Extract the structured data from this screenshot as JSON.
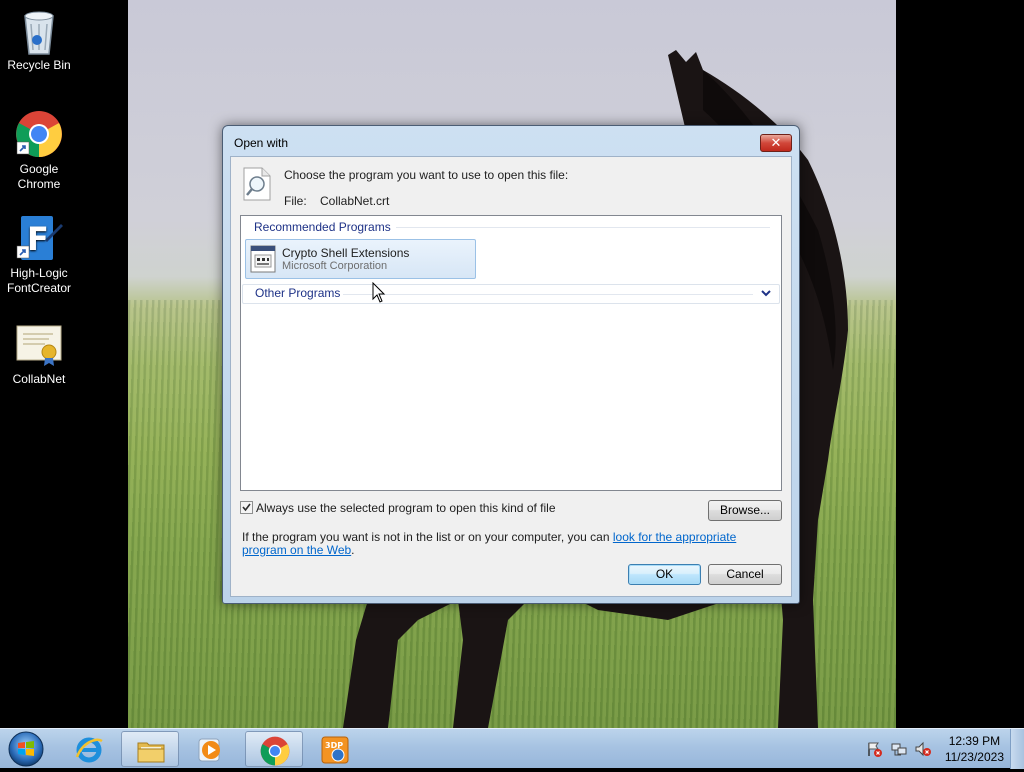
{
  "desktop": {
    "icons": [
      {
        "label": "Recycle Bin",
        "icon": "recycle-bin-icon"
      },
      {
        "label": "Google Chrome",
        "icon": "chrome-icon"
      },
      {
        "label": "High-Logic FontCreator",
        "icon": "fontcreator-icon"
      },
      {
        "label": "CollabNet",
        "icon": "certificate-icon"
      }
    ]
  },
  "dialog": {
    "title": "Open with",
    "close_label": "✕",
    "prompt": "Choose the program you want to use to open this file:",
    "file_label": "File:",
    "file_name": "CollabNet.crt",
    "recommended_title": "Recommended Programs",
    "recommended_programs": [
      {
        "name": "Crypto Shell Extensions",
        "publisher": "Microsoft Corporation",
        "icon": "crypto-shell-icon"
      }
    ],
    "other_title": "Other Programs",
    "other_expanded": false,
    "always_use_checked": true,
    "always_use_label": "Always use the selected program to open this kind of file",
    "browse_label": "Browse...",
    "info_text": "If the program you want is not in the list or on your computer, you can ",
    "info_link": "look for the appropriate program on the Web",
    "info_end": ".",
    "ok_label": "OK",
    "cancel_label": "Cancel"
  },
  "taskbar": {
    "start_icon": "windows-start-orb-icon",
    "pinned": [
      {
        "name": "Internet Explorer",
        "icon": "internet-explorer-icon",
        "active": false
      },
      {
        "name": "Windows Explorer",
        "icon": "folder-icon",
        "active": true
      },
      {
        "name": "Windows Media Player",
        "icon": "media-player-icon",
        "active": false
      },
      {
        "name": "Google Chrome",
        "icon": "chrome-icon",
        "active": true
      },
      {
        "name": "3DP Chip",
        "icon": "3dp-icon",
        "active": false
      }
    ],
    "tray": {
      "icons": [
        "action-center-flag-icon",
        "network-icon",
        "volume-muted-icon"
      ],
      "time": "12:39 PM",
      "date": "11/23/2023"
    }
  },
  "colors": {
    "link": "#0066cc",
    "group_title": "#1e3287",
    "dialog_frame": "#bcd3ea",
    "taskbar": "#a7c3e2"
  }
}
